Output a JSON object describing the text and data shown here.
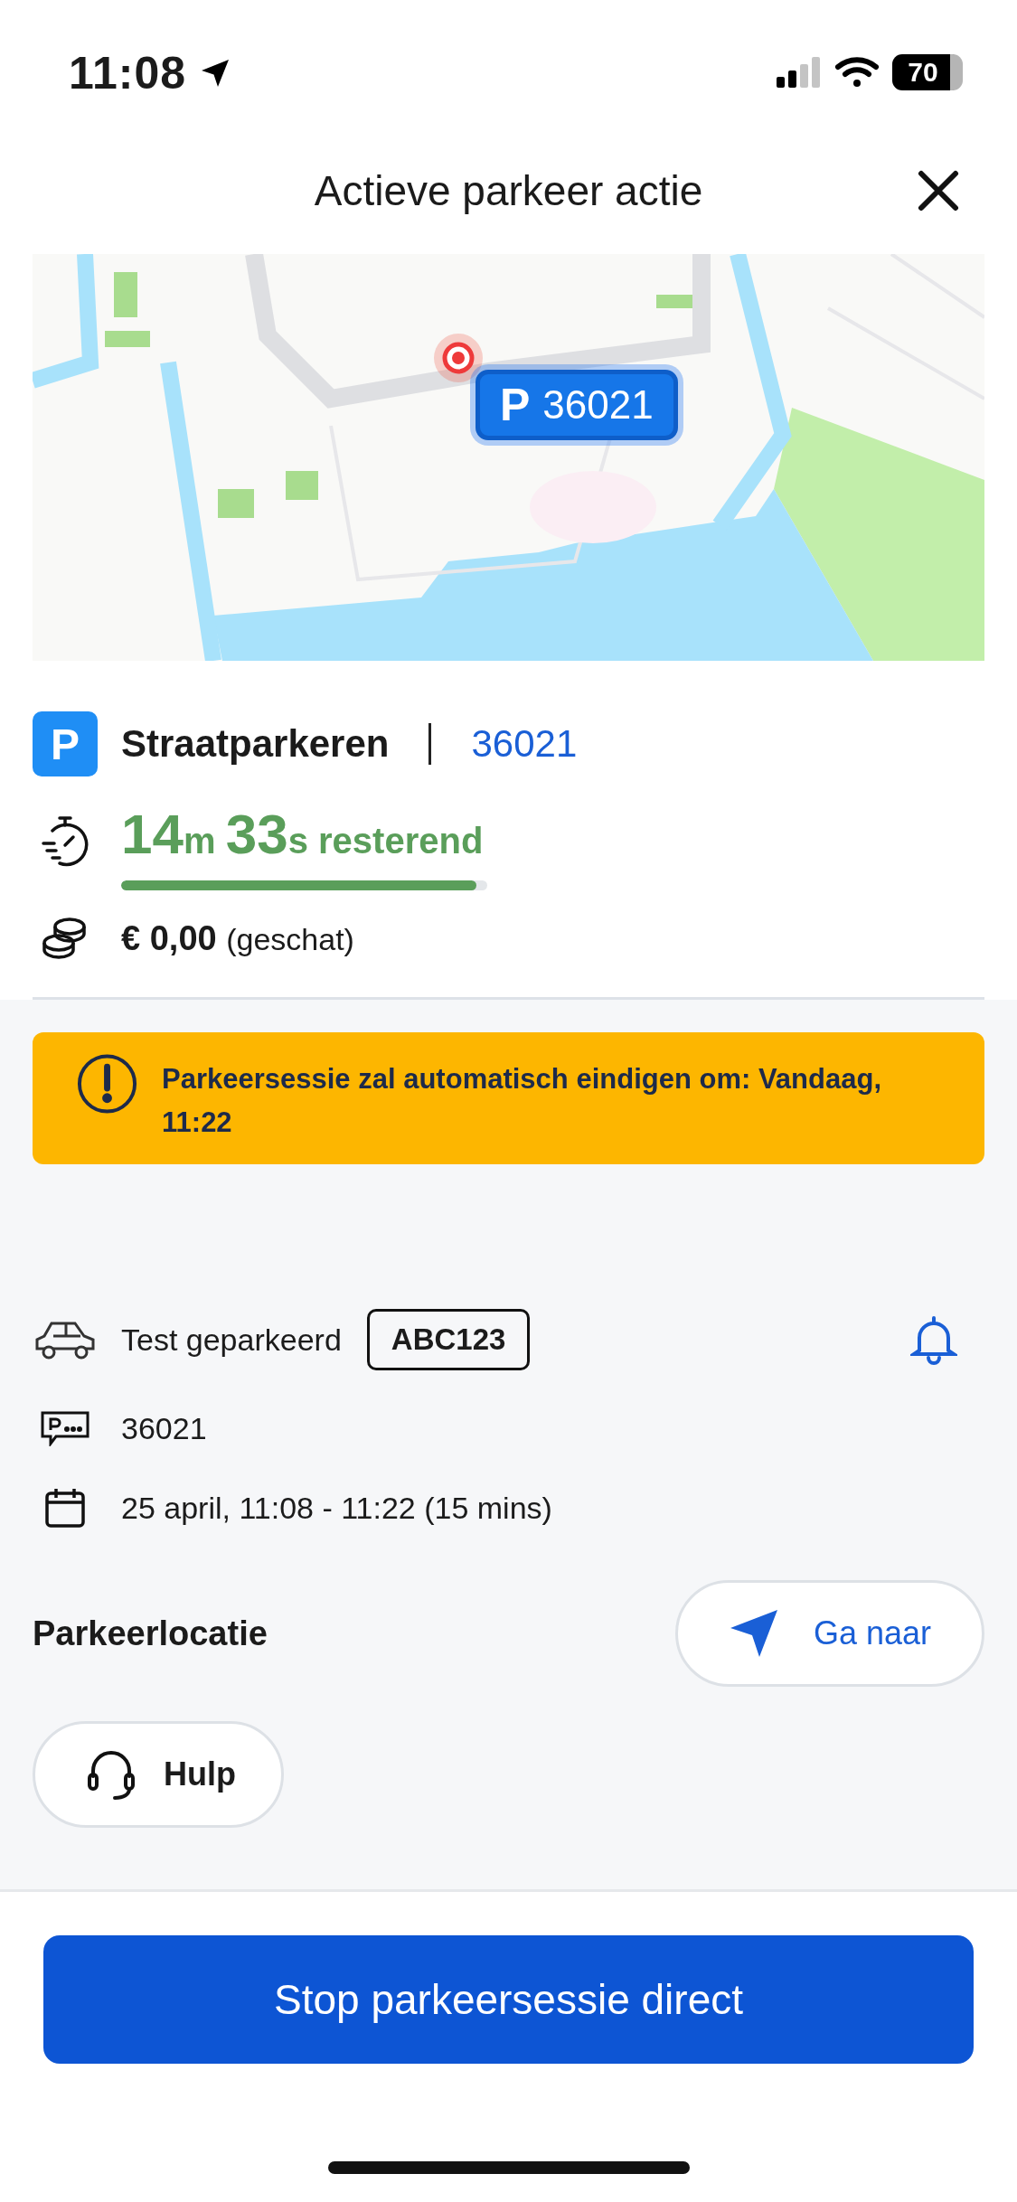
{
  "status_bar": {
    "time": "11:08",
    "battery": "70"
  },
  "header": {
    "title": "Actieve parkeer actie"
  },
  "map": {
    "kind": "picture",
    "marker": {
      "letter": "P",
      "label": "36021"
    }
  },
  "parking": {
    "badge": "P",
    "type": "Straatparkeren",
    "zone": "36021"
  },
  "timer": {
    "minutes": "14",
    "minutes_unit": "m",
    "seconds": "33",
    "seconds_unit": "s",
    "suffix": "resterend",
    "level": 0.97
  },
  "cost": {
    "amount": "€ 0,00",
    "note": "(geschat)"
  },
  "alert": {
    "text": "Parkeersessie zal automatisch eindigen om: Vandaag, 11:22"
  },
  "details": [
    {
      "kind": "vehicle",
      "text": "Test geparkeerd",
      "plate": "ABC123"
    },
    {
      "kind": "zone",
      "text": "36021"
    },
    {
      "kind": "time",
      "text": "25 april, 11:08 - 11:22 (15 mins)"
    }
  ],
  "location": {
    "heading": "Parkeerlocatie",
    "button": "Ga naar"
  },
  "help_button": "Hulp",
  "stop_button": "Stop parkeersessie direct"
}
